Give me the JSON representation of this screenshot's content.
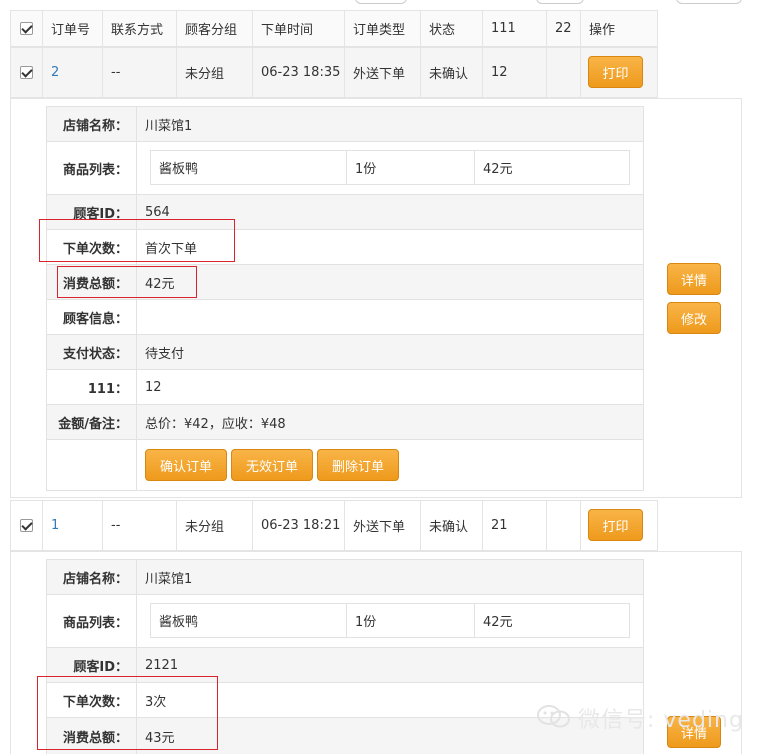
{
  "headers": [
    "订单号",
    "联系方式",
    "顾客分组",
    "下单时间",
    "订单类型",
    "状态",
    "111",
    "22",
    "操作"
  ],
  "print_label": "打印",
  "details_label": "详情",
  "edit_label": "修改",
  "order1": {
    "id": "2",
    "contact": "--",
    "group": "未分组",
    "time": "06-23 18:35",
    "type": "外送下单",
    "status": "未确认",
    "col111": "12",
    "labels": {
      "shop": "店铺名称：",
      "products": "商品列表：",
      "customer_id": "顾客ID：",
      "order_count": "下单次数：",
      "total": "消费总额：",
      "customer_info": "顾客信息：",
      "pay_status": "支付状态：",
      "f111": "111：",
      "amount_note": "金额/备注："
    },
    "shop": "川菜馆1",
    "product": {
      "name": "酱板鸭",
      "qty": "1份",
      "price": "42元"
    },
    "customer_id": "564",
    "order_count": "首次下单",
    "total": "42元",
    "customer_info": "",
    "pay_status": "待支付",
    "f111": "12",
    "amount_note": "总价：¥42，应收：¥48",
    "actions": [
      "确认订单",
      "无效订单",
      "删除订单"
    ]
  },
  "order2": {
    "id": "1",
    "contact": "--",
    "group": "未分组",
    "time": "06-23 18:21",
    "type": "外送下单",
    "status": "未确认",
    "col111": "21",
    "labels": {
      "shop": "店铺名称：",
      "products": "商品列表：",
      "customer_id": "顾客ID：",
      "order_count": "下单次数：",
      "total": "消费总额："
    },
    "shop": "川菜馆1",
    "product": {
      "name": "酱板鸭",
      "qty": "1份",
      "price": "42元"
    },
    "customer_id": "2121",
    "order_count": "3次",
    "total": "43元"
  },
  "watermark": "微信号: veding",
  "icons": {
    "checkbox": "checkbox-checked-icon",
    "wechat": "wechat-icon"
  },
  "colors": {
    "accent": "#f0a22e",
    "link": "#337ab7",
    "highlight": "#d9232d"
  }
}
